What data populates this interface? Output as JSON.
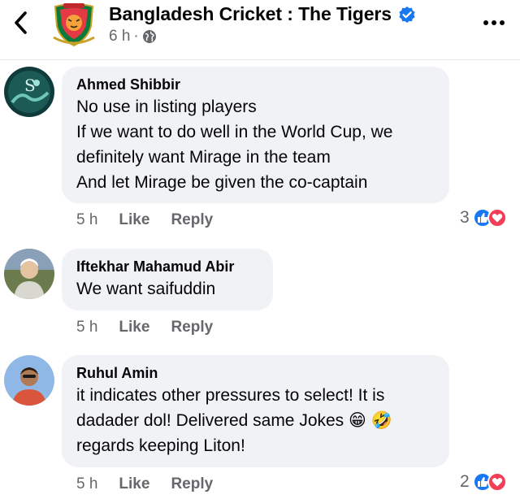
{
  "header": {
    "page_name": "Bangladesh Cricket : The Tigers",
    "time": "6 h",
    "separator": "·"
  },
  "comments": [
    {
      "author": "Ahmed Shibbir",
      "lines": [
        "No use in listing players",
        "If we want to do well in the World Cup, we",
        "definitely want Mirage in the team",
        "And let Mirage be given the co-captain"
      ],
      "time": "5 h",
      "like": "Like",
      "reply": "Reply",
      "reaction_count": "3"
    },
    {
      "author": "Iftekhar Mahamud Abir",
      "lines": [
        "We want saifuddin"
      ],
      "time": "5 h",
      "like": "Like",
      "reply": "Reply"
    },
    {
      "author": "Ruhul Amin",
      "lines": [
        "it indicates other pressures to select! It is",
        "dadader dol! Delivered same Jokes 😁 🤣",
        "regards keeping Liton!"
      ],
      "time": "5 h",
      "like": "Like",
      "reply": "Reply",
      "reaction_count": "2"
    }
  ],
  "icons": [
    "back-arrow-icon",
    "verified-badge-icon",
    "globe-icon",
    "more-options-icon",
    "like-reaction-icon",
    "love-reaction-icon"
  ],
  "colors": {
    "facebook_blue": "#1877f2",
    "love_red": "#f33e58",
    "bubble_bg": "#f0f2f5",
    "muted_text": "#65676b"
  }
}
